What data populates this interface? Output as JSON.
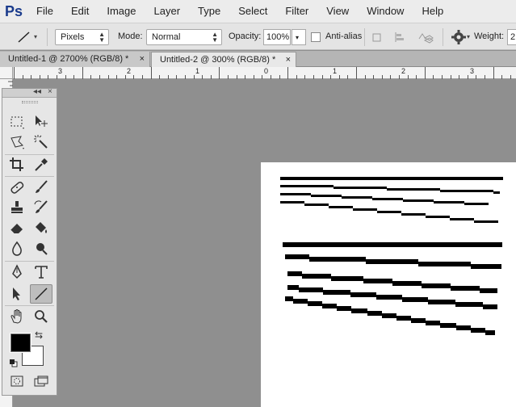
{
  "app": {
    "logo": "Ps"
  },
  "menu": [
    "File",
    "Edit",
    "Image",
    "Layer",
    "Type",
    "Select",
    "Filter",
    "View",
    "Window",
    "Help"
  ],
  "options": {
    "units": "Pixels",
    "mode_label": "Mode:",
    "mode_value": "Normal",
    "opacity_label": "Opacity:",
    "opacity_value": "100%",
    "antialias_label": "Anti-alias",
    "weight_label": "Weight:",
    "weight_value": "2"
  },
  "tabs": [
    {
      "label": "Untitled-1 @ 2700% (RGB/8) *",
      "close": "×"
    },
    {
      "label": "Untitled-2 @ 300% (RGB/8) *",
      "close": "×"
    }
  ],
  "ruler": {
    "top_labels": [
      "3",
      "2",
      "1",
      "0",
      "1",
      "2",
      "3"
    ]
  },
  "tools_panel": {
    "collapse": "◂◂",
    "close": "×"
  },
  "colors": {
    "foreground": "#000000",
    "background": "#ffffff"
  }
}
